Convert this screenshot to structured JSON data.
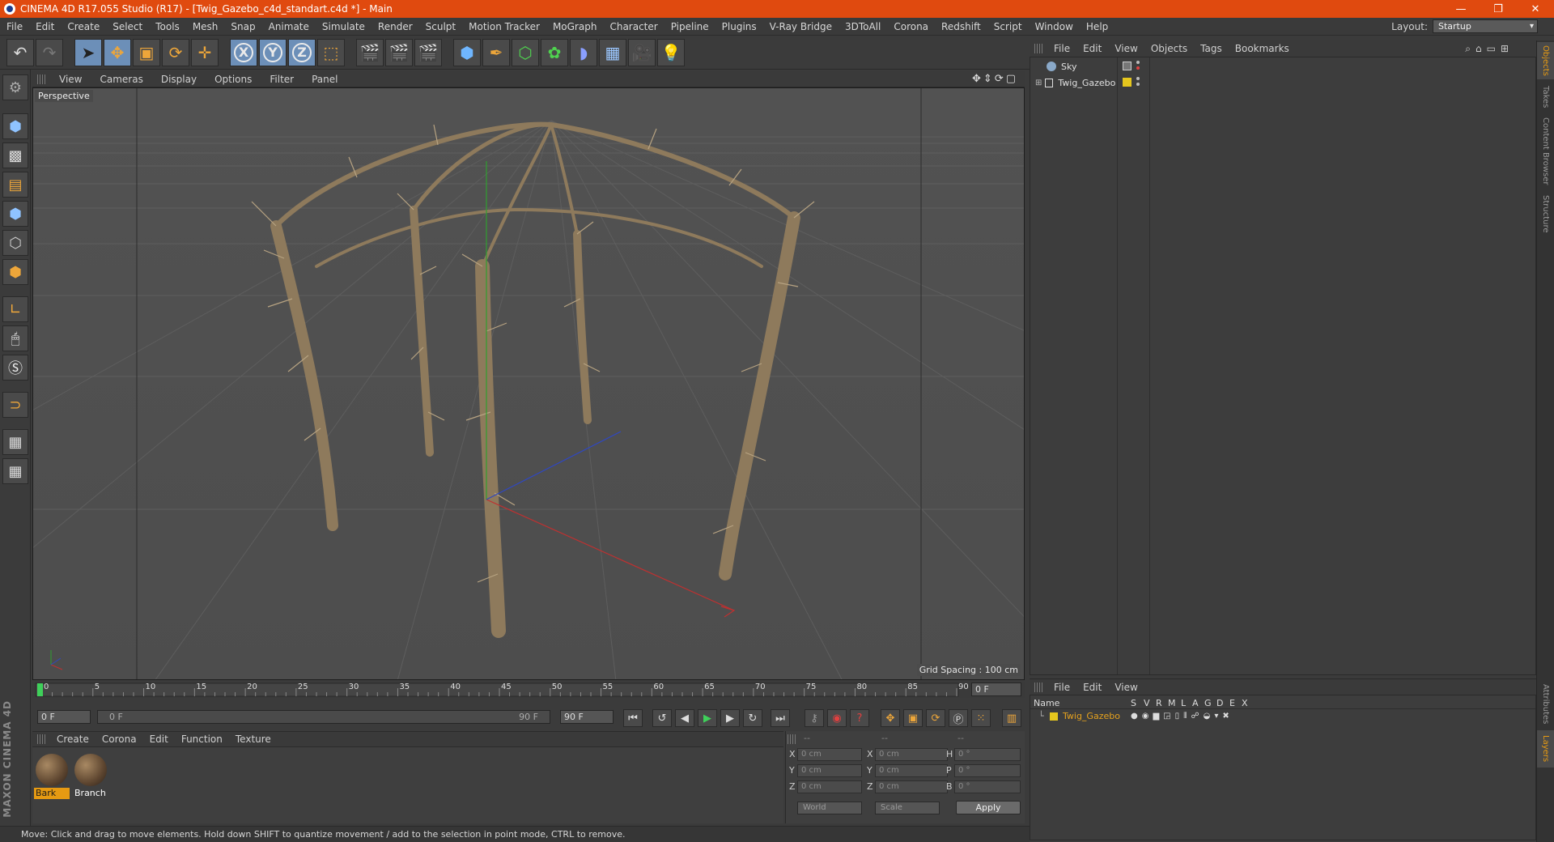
{
  "window": {
    "title": "CINEMA 4D R17.055 Studio (R17) - [Twig_Gazebo_c4d_standart.c4d *] - Main",
    "min": "—",
    "restore": "❐",
    "close": "✕"
  },
  "menubar": {
    "items": [
      "File",
      "Edit",
      "Create",
      "Select",
      "Tools",
      "Mesh",
      "Snap",
      "Animate",
      "Simulate",
      "Render",
      "Sculpt",
      "Motion Tracker",
      "MoGraph",
      "Character",
      "Pipeline",
      "Plugins",
      "V-Ray Bridge",
      "3DToAll",
      "Corona",
      "Redshift",
      "Script",
      "Window",
      "Help"
    ],
    "layout_label": "Layout:",
    "layout_value": "Startup"
  },
  "viewport": {
    "menu": [
      "View",
      "Cameras",
      "Display",
      "Options",
      "Filter",
      "Panel"
    ],
    "label": "Perspective",
    "grid_spacing": "Grid Spacing : 100 cm",
    "nav_icons": "✥⇕⟳▢"
  },
  "timeline": {
    "ticks": [
      "0",
      "5",
      "10",
      "15",
      "20",
      "25",
      "30",
      "35",
      "40",
      "45",
      "50",
      "55",
      "60",
      "65",
      "70",
      "75",
      "80",
      "85",
      "90"
    ],
    "current_frame": "0 F",
    "start_field": "0 F",
    "range_start": "0 F",
    "range_end": "90 F",
    "end_field": "90 F"
  },
  "materials": {
    "menu": [
      "Create",
      "Corona",
      "Edit",
      "Function",
      "Texture"
    ],
    "items": [
      {
        "name": "Bark",
        "active": true
      },
      {
        "name": "Branch",
        "active": false
      }
    ]
  },
  "coordinates": {
    "header": [
      "--",
      "--",
      "--"
    ],
    "rows": [
      {
        "a": "X",
        "av": "0 cm",
        "b": "X",
        "bv": "0 cm",
        "c": "H",
        "cv": "0 °"
      },
      {
        "a": "Y",
        "av": "0 cm",
        "b": "Y",
        "bv": "0 cm",
        "c": "P",
        "cv": "0 °"
      },
      {
        "a": "Z",
        "av": "0 cm",
        "b": "Z",
        "bv": "0 cm",
        "c": "B",
        "cv": "0 °"
      }
    ],
    "mode": "World",
    "type": "Scale",
    "apply": "Apply"
  },
  "objects": {
    "menu": [
      "File",
      "Edit",
      "View",
      "Objects",
      "Tags",
      "Bookmarks"
    ],
    "items": [
      {
        "name": "Sky",
        "icon": "sky-icon"
      },
      {
        "name": "Twig_Gazebo",
        "icon": "null-object-icon"
      }
    ]
  },
  "layers": {
    "menu": [
      "File",
      "Edit",
      "View"
    ],
    "columns": [
      "Name",
      "S",
      "V",
      "R",
      "M",
      "L",
      "A",
      "G",
      "D",
      "E",
      "X"
    ],
    "items": [
      {
        "name": "Twig_Gazebo",
        "color": "#e6c71e"
      }
    ]
  },
  "right_tabs": [
    "Objects",
    "Takes",
    "Content Browser",
    "Structure",
    "Attributes",
    "Layers"
  ],
  "status": "Move: Click and drag to move elements. Hold down SHIFT to quantize movement / add to the selection in point mode, CTRL to remove.",
  "branding": "MAXON CINEMA 4D",
  "colors": {
    "accent": "#e69a12",
    "titlebar": "#e04a0f",
    "axis_x": "#c03030",
    "axis_y": "#2fa02f",
    "axis_z": "#3048c0"
  }
}
